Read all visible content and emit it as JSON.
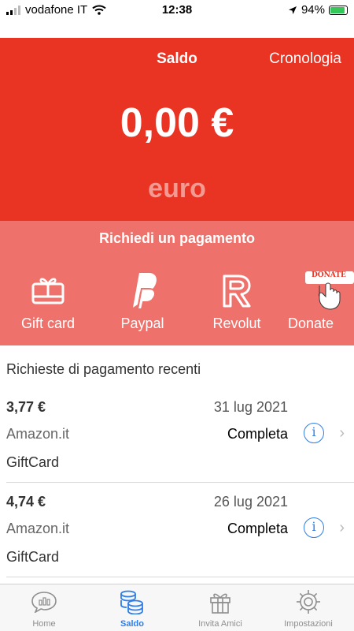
{
  "status_bar": {
    "carrier": "vodafone IT",
    "time": "12:38",
    "battery": "94%",
    "battery_level": 0.94
  },
  "header": {
    "title": "Saldo",
    "history_link": "Cronologia",
    "balance": "0,00 €",
    "currency_label": "euro"
  },
  "request": {
    "title": "Richiedi un pagamento",
    "methods": [
      {
        "label": "Gift card",
        "icon": "gift-card-icon"
      },
      {
        "label": "Paypal",
        "icon": "paypal-icon"
      },
      {
        "label": "Revolut",
        "icon": "revolut-icon"
      },
      {
        "label": "Donate",
        "icon": "donate-icon",
        "badge": "DONATE"
      }
    ]
  },
  "recent": {
    "title": "Richieste di pagamento recenti",
    "items": [
      {
        "amount": "3,77 €",
        "date": "31 lug 2021",
        "merchant": "Amazon.it",
        "status": "Completa",
        "type": "GiftCard"
      },
      {
        "amount": "4,74 €",
        "date": "26 lug 2021",
        "merchant": "Amazon.it",
        "status": "Completa",
        "type": "GiftCard"
      }
    ]
  },
  "tabs": [
    {
      "label": "Home",
      "icon": "chat-chart-icon"
    },
    {
      "label": "Saldo",
      "icon": "coins-icon",
      "active": true
    },
    {
      "label": "Invita Amici",
      "icon": "gift-icon"
    },
    {
      "label": "Impostazioni",
      "icon": "gear-icon"
    }
  ],
  "colors": {
    "brand_red": "#e93323",
    "panel_red": "#ee726b",
    "accent_blue": "#2f7ee8"
  }
}
